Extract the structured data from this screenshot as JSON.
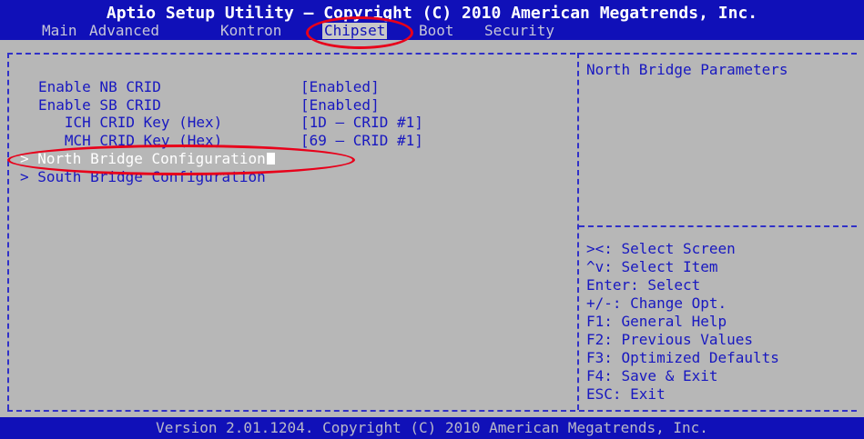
{
  "title": "Aptio Setup Utility – Copyright (C) 2010 American Megatrends, Inc.",
  "menu": [
    "Main",
    "Advanced",
    "Kontron",
    "Chipset",
    "Boot",
    "Security"
  ],
  "active_tab": "Chipset",
  "settings": [
    {
      "label": "Enable NB CRID",
      "value": "[Enabled]"
    },
    {
      "label": "Enable SB CRID",
      "value": "[Enabled]"
    },
    {
      "label": "   ICH CRID Key (Hex)",
      "value": "[1D – CRID #1]"
    },
    {
      "label": "   MCH CRID Key (Hex)",
      "value": "[69 – CRID #1]"
    }
  ],
  "submenus": [
    {
      "label": "North Bridge Configuration"
    },
    {
      "label": "South Bridge Configuration"
    }
  ],
  "help_title": "North Bridge Parameters",
  "help_keys": [
    "><: Select Screen",
    "^v: Select Item",
    "Enter: Select",
    "+/-: Change Opt.",
    "F1: General Help",
    "F2: Previous Values",
    "F3: Optimized Defaults",
    "F4: Save & Exit",
    "ESC: Exit"
  ],
  "footer": "Version 2.01.1204. Copyright (C) 2010 American Megatrends, Inc.",
  "colors": {
    "background": "#b7b7b7",
    "bar": "#1010b8",
    "text": "#1818c0",
    "highlight": "#ffffff",
    "annotation": "#e8001a"
  }
}
